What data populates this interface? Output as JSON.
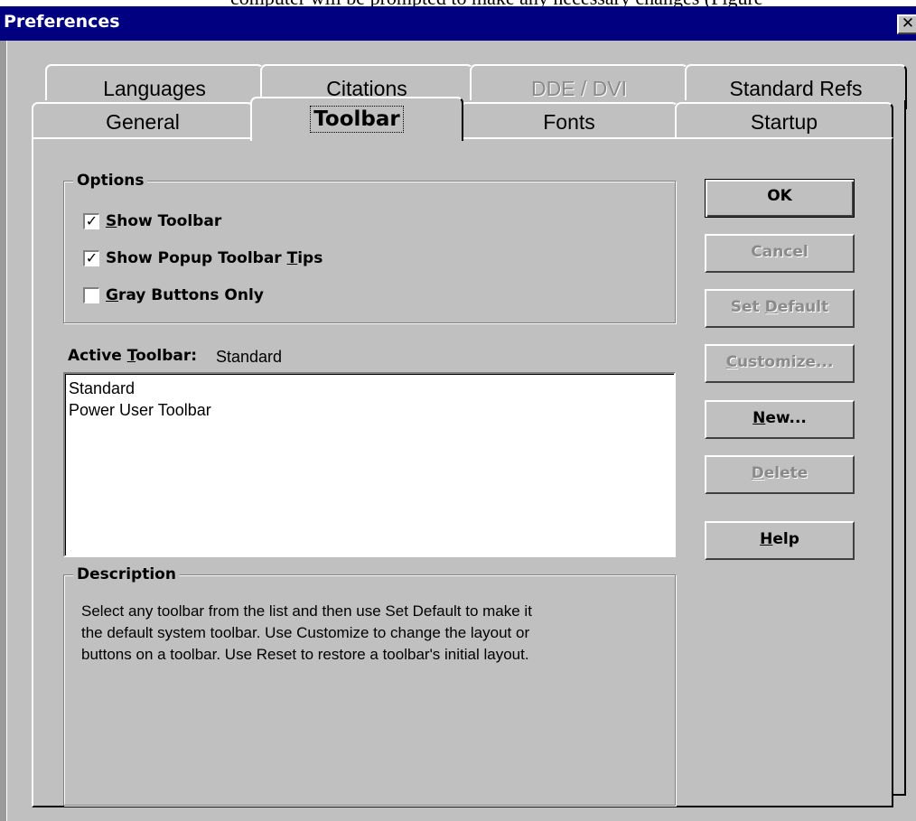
{
  "document_strip": "computer will be prompted to make any necessary changes (Figure",
  "window": {
    "title": "Preferences",
    "close_glyph": "✕"
  },
  "tabs_back": [
    {
      "label": "Languages",
      "enabled": true
    },
    {
      "label": "Citations",
      "enabled": true
    },
    {
      "label": "DDE / DVI",
      "enabled": false
    },
    {
      "label": "Standard Refs",
      "enabled": true
    }
  ],
  "tabs_front": [
    {
      "label": "General",
      "selected": false
    },
    {
      "label": "Toolbar",
      "selected": true
    },
    {
      "label": "Fonts",
      "selected": false
    },
    {
      "label": "Startup",
      "selected": false
    }
  ],
  "options": {
    "legend": "Options",
    "show_toolbar": {
      "mnemonic": "S",
      "rest": "how Toolbar",
      "checked": true
    },
    "show_tips": {
      "prefix": "Show Popup Toolbar ",
      "mnemonic": "T",
      "rest": "ips",
      "checked": true
    },
    "gray_buttons": {
      "mnemonic": "G",
      "rest": "ray Buttons Only",
      "checked": false
    },
    "check_glyph": "✓"
  },
  "active_toolbar": {
    "label_prefix": "Active ",
    "label_mnemonic": "T",
    "label_rest": "oolbar:",
    "value": "Standard"
  },
  "toolbar_list": [
    "Standard",
    "Power User Toolbar"
  ],
  "description": {
    "legend": "Description",
    "line1": "Select any toolbar from the list and then use Set Default to make it",
    "line2": "the default system toolbar. Use Customize to change the layout or",
    "line3": "buttons on a toolbar. Use Reset to restore a toolbar's initial layout."
  },
  "buttons": {
    "ok": "OK",
    "cancel": "Cancel",
    "set_default_prefix": "Set ",
    "set_default_mnemonic": "D",
    "set_default_rest": "efault",
    "customize_mnemonic": "C",
    "customize_rest": "ustomize...",
    "new_mnemonic": "N",
    "new_rest": "ew...",
    "delete_mnemonic": "D",
    "delete_rest": "elete",
    "help_mnemonic": "H",
    "help_rest": "elp"
  }
}
